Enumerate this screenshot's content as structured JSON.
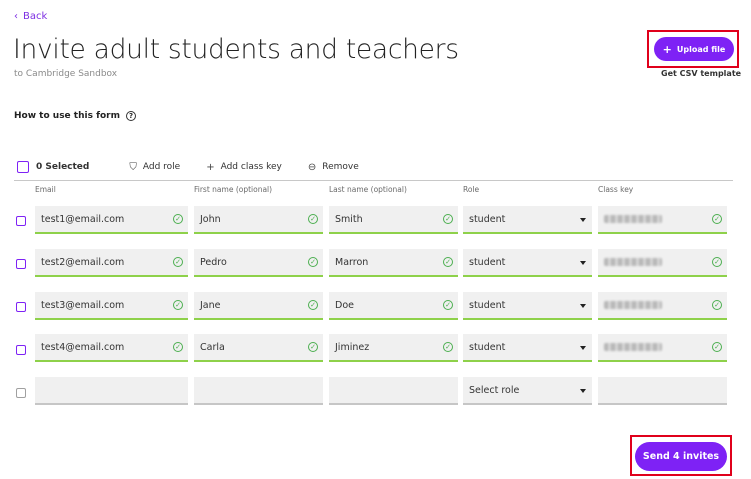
{
  "nav": {
    "back_label": "Back",
    "back_icon": "chevron-left-icon"
  },
  "page": {
    "title": "Invite adult students and teachers",
    "subtitle": "to Cambridge Sandbox"
  },
  "actions": {
    "upload_label": "Upload file",
    "csv_link": "Get CSV template",
    "send_label": "Send 4 invites"
  },
  "help": {
    "label": "How to use this form",
    "icon": "question-circle-icon"
  },
  "toolbar": {
    "selected_label": "0 Selected",
    "add_role": "Add role",
    "add_class_key": "Add class key",
    "remove": "Remove"
  },
  "columns": [
    "Email",
    "First name (optional)",
    "Last name (optional)",
    "Role",
    "Class key"
  ],
  "rows": [
    {
      "email": "test1@email.com",
      "first": "John",
      "last": "Smith",
      "role": "student"
    },
    {
      "email": "test2@email.com",
      "first": "Pedro",
      "last": "Marron",
      "role": "student"
    },
    {
      "email": "test3@email.com",
      "first": "Jane",
      "last": "Doe",
      "role": "student"
    },
    {
      "email": "test4@email.com",
      "first": "Carla",
      "last": "Jiminez",
      "role": "student"
    }
  ],
  "empty_row": {
    "role_placeholder": "Select role"
  },
  "colors": {
    "accent": "#7e22f5",
    "valid": "#8ed14a",
    "highlight": "#e0001b"
  }
}
